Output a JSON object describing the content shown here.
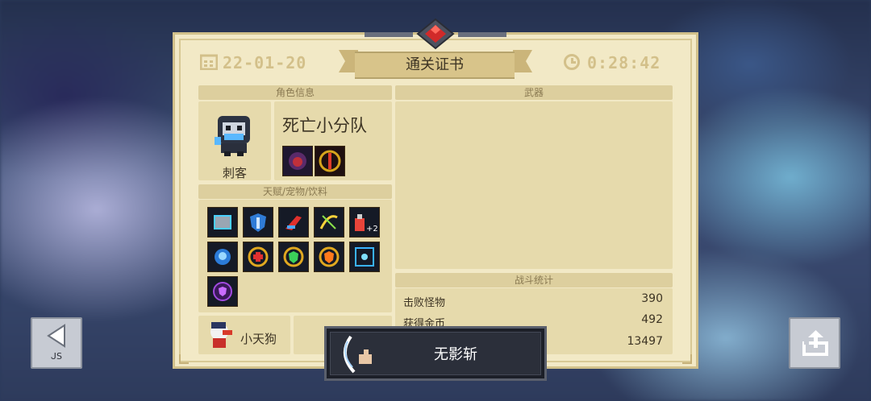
{
  "certificate": {
    "date": "22-01-20",
    "title": "通关证书",
    "time": "0:28:42"
  },
  "sections": {
    "character_info": "角色信息",
    "weapons": "武器",
    "talents": "天赋/宠物/饮料",
    "battle_stats": "战斗统计"
  },
  "character": {
    "class_name": "刺客",
    "team_name": "死亡小分队",
    "pet_name": "小天狗"
  },
  "skill": {
    "name": "无影斩"
  },
  "stats": [
    {
      "label": "击败怪物",
      "value": "390"
    },
    {
      "label": "获得金币",
      "value": "492"
    },
    {
      "label": "",
      "value": "13497"
    }
  ],
  "buttons": {
    "back_label": "ᒍS"
  },
  "talent_icons": [
    "tablet-icon",
    "shield-blue-icon",
    "dash-red-icon",
    "crossbow-icon",
    "potion-plus2-icon",
    "brain-icon",
    "heart-shield-icon",
    "green-shield-icon",
    "fire-shield-icon",
    "sparkle-icon",
    "purple-shield-icon"
  ],
  "colors": {
    "panel": "#f2e9c6",
    "section": "#ddcf9e",
    "text": "#3d3424"
  }
}
